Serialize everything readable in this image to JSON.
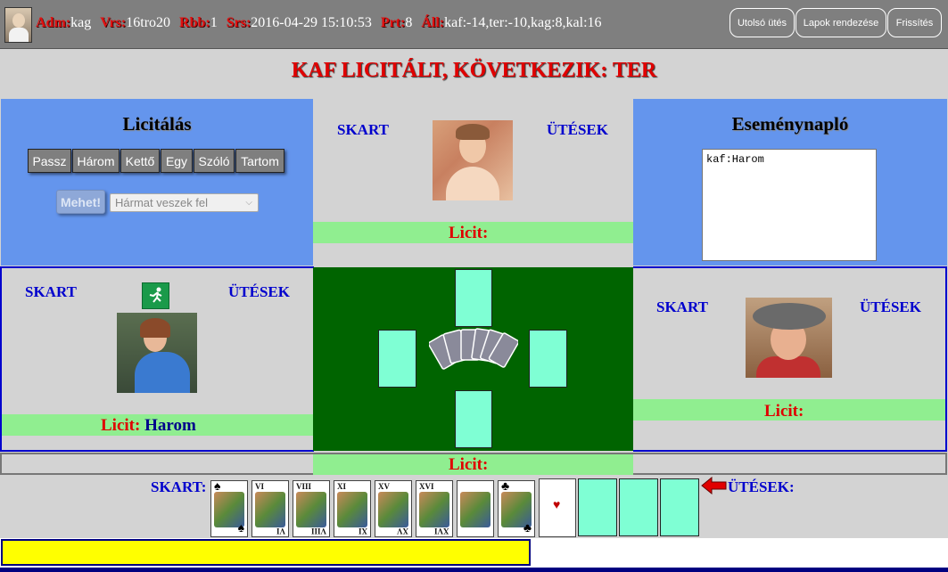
{
  "status": {
    "adm_key": "Adm:",
    "adm_val": "kag",
    "vrs_key": "Vrs:",
    "vrs_val": "16tro20",
    "rbb_key": "Rbb:",
    "rbb_val": "1",
    "srs_key": "Srs:",
    "srs_val": "2016-04-29 15:10:53",
    "prt_key": "Prt:",
    "prt_val": "8",
    "all_key": "Áll:",
    "all_val": "kaf:-14,ter:-10,kag:8,kal:16"
  },
  "top_buttons": {
    "last_trick": "Utolsó ütés",
    "sort_cards": "Lapok rendezése",
    "refresh": "Frissítés"
  },
  "headline": "KAF LICITÁLT, KÖVETKEZIK: TER",
  "bidding": {
    "title": "Licitálás",
    "buttons": [
      "Passz",
      "Három",
      "Kettő",
      "Egy",
      "Szóló",
      "Tartom"
    ],
    "go_label": "Mehet!",
    "select_value": "Hármat veszek fel"
  },
  "eventlog": {
    "title": "Eseménynapló",
    "content": "kaf:Harom"
  },
  "labels": {
    "skart": "SKART",
    "utesek": "ÜTÉSEK",
    "skart_colon": "SKART:",
    "utesek_colon": "ÜTÉSEK:"
  },
  "players": {
    "top": {
      "licit_label": "Licit:",
      "licit_value": ""
    },
    "left": {
      "licit_label": "Licit:",
      "licit_value": "Harom"
    },
    "right": {
      "licit_label": "Licit:",
      "licit_value": ""
    },
    "bottom": {
      "licit_label": "Licit:",
      "licit_value": ""
    }
  },
  "hand": [
    {
      "num": "",
      "suit": "♠"
    },
    {
      "num": "VI",
      "suit": ""
    },
    {
      "num": "VIII",
      "suit": ""
    },
    {
      "num": "XI",
      "suit": ""
    },
    {
      "num": "XV",
      "suit": ""
    },
    {
      "num": "XVI",
      "suit": ""
    },
    {
      "num": "",
      "suit": ""
    },
    {
      "num": "",
      "suit": "♣"
    },
    {
      "num": "",
      "suit": "♥"
    }
  ],
  "progress": 0.56,
  "colors": {
    "accent_red": "#e00000",
    "label_blue": "#0000cd",
    "panel_blue": "#6495ed",
    "licit_green": "#90ee90",
    "table_green": "#006400",
    "slot_aqua": "#7fffd4",
    "progress_yellow": "#ffff00"
  }
}
